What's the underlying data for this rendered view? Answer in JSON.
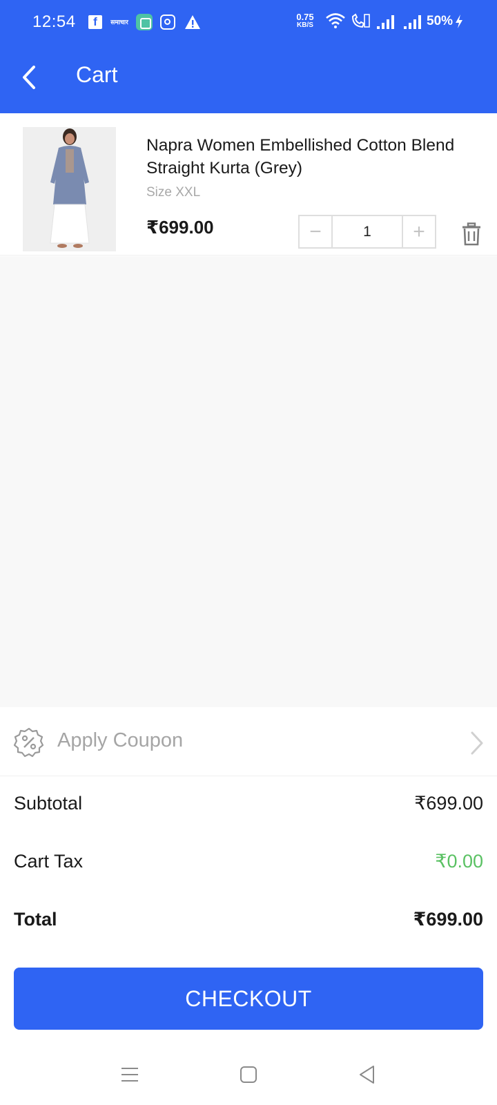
{
  "status_bar": {
    "time": "12:54",
    "news_icon_text": "समाचार",
    "speed_value": "0.75",
    "speed_unit": "KB/S",
    "battery": "50%"
  },
  "header": {
    "title": "Cart",
    "color": "#2f64f3"
  },
  "cart": {
    "items": [
      {
        "name": "Napra  Women Embellished Cotton Blend Straight Kurta  (Grey)",
        "size": "Size XXL",
        "price": "₹699.00",
        "quantity": "1",
        "minus_label": "−",
        "plus_label": "+"
      }
    ]
  },
  "coupon": {
    "label": "Apply Coupon"
  },
  "summary": {
    "subtotal_label": "Subtotal",
    "subtotal_value": "₹699.00",
    "tax_label": "Cart Tax",
    "tax_value": "₹0.00",
    "tax_color": "#5ac163",
    "total_label": "Total",
    "total_value": "₹699.00"
  },
  "checkout": {
    "label": "CHECKOUT"
  }
}
